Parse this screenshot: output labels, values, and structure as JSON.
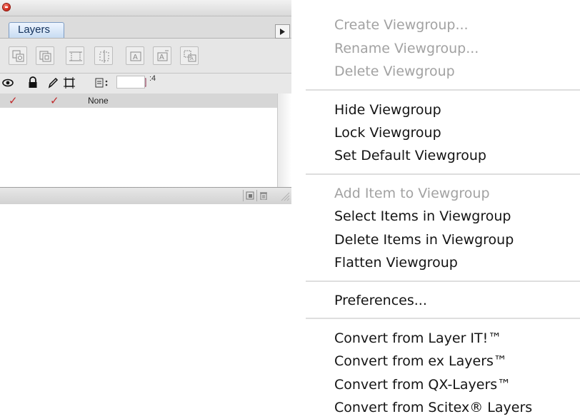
{
  "layers_palette": {
    "tab_label": "Layers",
    "count_label": ":4",
    "rows": [
      {
        "visible": true,
        "locked": false,
        "printable": true,
        "name": "None"
      }
    ]
  },
  "context_menu": {
    "groups": [
      [
        {
          "label": "Create Viewgroup...",
          "enabled": false
        },
        {
          "label": "Rename Viewgroup...",
          "enabled": false
        },
        {
          "label": "Delete Viewgroup",
          "enabled": false
        }
      ],
      [
        {
          "label": "Hide Viewgroup",
          "enabled": true
        },
        {
          "label": "Lock Viewgroup",
          "enabled": true
        },
        {
          "label": "Set Default Viewgroup",
          "enabled": true
        }
      ],
      [
        {
          "label": "Add Item to Viewgroup",
          "enabled": false
        },
        {
          "label": "Select Items in Viewgroup",
          "enabled": true
        },
        {
          "label": "Delete Items in Viewgroup",
          "enabled": true
        },
        {
          "label": "Flatten Viewgroup",
          "enabled": true
        }
      ],
      [
        {
          "label": "Preferences...",
          "enabled": true
        }
      ],
      [
        {
          "label": "Convert from Layer IT!™",
          "enabled": true
        },
        {
          "label": "Convert from ex Layers™",
          "enabled": true
        },
        {
          "label": "Convert from QX-Layers™",
          "enabled": true
        },
        {
          "label": "Convert from Scitex® Layers",
          "enabled": true
        }
      ]
    ]
  },
  "colors": {
    "check_mark": "#c0292b",
    "close_button": "#c81e10",
    "tab_blue": "#c8dcf2",
    "disabled_text": "#a2a2a2"
  },
  "icons": {
    "close": "close-icon",
    "palette_menu": "triangle-right-icon",
    "visibility": "eye-icon",
    "lock": "lock-icon",
    "print": "pencil-icon",
    "guides": "frame-icon",
    "new_layer": "new-layer-icon",
    "delete_layer": "trash-icon"
  }
}
